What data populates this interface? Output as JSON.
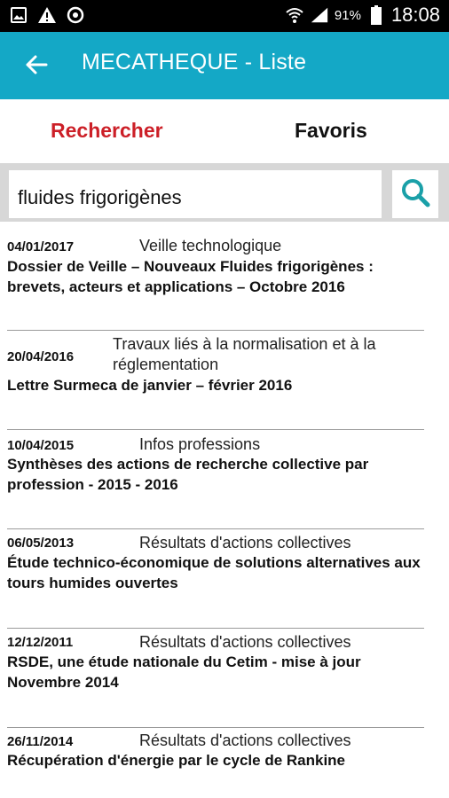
{
  "statusbar": {
    "icons": [
      "image-icon",
      "warning-icon",
      "sync-icon"
    ],
    "battery_percent": "91%",
    "time": "18:08"
  },
  "appbar": {
    "title": "MECATHEQUE - Liste",
    "color": "#14a8c6"
  },
  "tabs": [
    {
      "label": "Rechercher",
      "active": true,
      "color": "#cc1f27"
    },
    {
      "label": "Favoris",
      "active": false,
      "color": "#111111"
    }
  ],
  "search": {
    "value": "fluides frigorigènes",
    "button_icon": "search-icon"
  },
  "results": [
    {
      "date": "04/01/2017",
      "category": "Veille technologique",
      "title": "Dossier de Veille – Nouveaux Fluides frigorigènes : brevets, acteurs et applications – Octobre 2016"
    },
    {
      "date": "20/04/2016",
      "category": "Travaux liés à la normalisation et à la réglementation",
      "title": "Lettre Surmeca de janvier – février 2016"
    },
    {
      "date": "10/04/2015",
      "category": "Infos professions",
      "title": "Synthèses des actions de recherche collective par profession - 2015 - 2016"
    },
    {
      "date": "06/05/2013",
      "category": "Résultats d'actions collectives",
      "title": "Étude technico-économique de solutions alternatives aux tours humides ouvertes"
    },
    {
      "date": "12/12/2011",
      "category": "Résultats d'actions collectives",
      "title": "RSDE, une étude nationale du Cetim - mise à jour Novembre 2014"
    },
    {
      "date": "26/11/2014",
      "category": "Résultats d'actions collectives",
      "title": "Récupération d'énergie par le cycle de Rankine"
    }
  ]
}
